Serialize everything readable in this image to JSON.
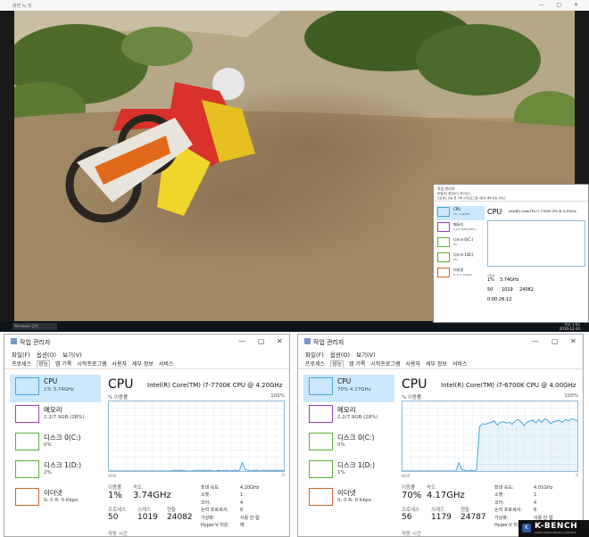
{
  "viewer": {
    "title": "화면 녹 및",
    "window_controls": "—  ▢  ✕"
  },
  "taskbar": {
    "search": "Windows 검색",
    "time": "오후 1:41",
    "date": "2016-12-30"
  },
  "colors": {
    "cpu": "#4aa3d8",
    "memory": "#9b3fbd",
    "disk": "#5cb038",
    "net": "#c9682f"
  },
  "left": {
    "title": "작업 관리자",
    "menu": [
      "파일(F)",
      "옵션(O)",
      "보기(V)"
    ],
    "tabs": [
      "프로세스",
      "성능",
      "앱 기록",
      "시작프로그램",
      "사용자",
      "세부 정보",
      "서비스"
    ],
    "active_tab": 1,
    "sidebar": [
      {
        "name": "CPU",
        "sub": "1% 3.74GHz",
        "icon": "cpu-thumb"
      },
      {
        "name": "메모리",
        "sub": "2.2/7.9GB (28%)",
        "icon": "memory-thumb"
      },
      {
        "name": "디스크 0(C:)",
        "sub": "0%",
        "icon": "disk-thumb"
      },
      {
        "name": "디스크 1(D:)",
        "sub": "2%",
        "icon": "disk-thumb"
      },
      {
        "name": "이더넷",
        "sub": "S: 0 R: 0 Kbps",
        "icon": "ethernet-thumb"
      }
    ],
    "header": "CPU",
    "model": "Intel(R) Core(TM) i7-7700K CPU @ 4.20GHz",
    "ylabel": "% 이용률",
    "ymax": "100%",
    "xlabel": "60초",
    "xmin": "0",
    "usage_label": "이용률",
    "usage": "1%",
    "speed_label": "속도",
    "speed": "3.74GHz",
    "proc_label": "프로세스",
    "proc": "50",
    "threads_label": "스레드",
    "threads": "1019",
    "handles_label": "핸들",
    "handles": "24082",
    "uptime_label": "작동 시간",
    "kv_labels": [
      "최대 속도:",
      "소켓:",
      "코어:",
      "논리 프로세서:",
      "가상화:",
      "Hyper-V 지원:"
    ],
    "kv_values": [
      "4.20GHz",
      "1",
      "4",
      "8",
      "사용 안 함",
      "예"
    ],
    "cpu_graph": [
      0,
      0,
      0,
      0,
      0,
      0,
      0,
      0,
      0,
      0,
      0,
      0,
      0,
      0,
      0,
      0,
      0,
      0,
      0,
      0,
      0,
      0,
      1,
      1,
      1,
      1,
      0,
      0,
      0,
      1,
      1,
      1,
      1,
      1,
      1,
      0,
      0,
      1,
      0,
      1,
      1,
      0,
      1,
      1,
      0,
      12,
      2,
      1,
      0,
      1,
      1,
      0,
      1,
      1,
      1,
      1,
      1,
      1,
      1,
      1
    ]
  },
  "right": {
    "title": "작업 관리자",
    "menu": [
      "파일(F)",
      "옵션(O)",
      "보기(V)"
    ],
    "tabs": [
      "프로세스",
      "성능",
      "앱 기록",
      "시작프로그램",
      "사용자",
      "세부 정보",
      "서비스"
    ],
    "active_tab": 1,
    "sidebar": [
      {
        "name": "CPU",
        "sub": "70% 4.17GHz",
        "icon": "cpu-thumb"
      },
      {
        "name": "메모리",
        "sub": "2.2/7.9GB (28%)",
        "icon": "memory-thumb"
      },
      {
        "name": "디스크 0(C:)",
        "sub": "0%",
        "icon": "disk-thumb"
      },
      {
        "name": "디스크 1(D:)",
        "sub": "1%",
        "icon": "disk-thumb"
      },
      {
        "name": "이더넷",
        "sub": "S: 0 R: 0 Kbps",
        "icon": "ethernet-thumb"
      }
    ],
    "header": "CPU",
    "model": "Intel(R) Core(TM) i7-6700K CPU @ 4.00GHz",
    "ylabel": "% 이용률",
    "ymax": "100%",
    "xlabel": "60초",
    "xmin": "0",
    "usage_label": "이용률",
    "usage": "70%",
    "speed_label": "속도",
    "speed": "4.17GHz",
    "proc_label": "프로세스",
    "proc": "56",
    "threads_label": "스레드",
    "threads": "1179",
    "handles_label": "핸들",
    "handles": "24787",
    "uptime_label": "작동 시간",
    "kv_labels": [
      "최대 속도:",
      "소켓:",
      "코어:",
      "논리 프로세서:",
      "가상화:",
      "Hyper-V 지원:"
    ],
    "kv_values": [
      "4.01GHz",
      "1",
      "4",
      "8",
      "사용 안 함",
      "예"
    ],
    "cpu_graph": [
      0,
      0,
      0,
      0,
      0,
      0,
      0,
      0,
      0,
      0,
      0,
      0,
      0,
      0,
      0,
      0,
      0,
      0,
      0,
      12,
      2,
      1,
      0,
      1,
      0,
      2,
      64,
      68,
      67,
      69,
      70,
      72,
      66,
      70,
      71,
      69,
      70,
      67,
      72,
      74,
      71,
      65,
      70,
      72,
      73,
      69,
      74,
      70,
      75,
      73,
      68,
      71,
      72,
      73,
      70,
      74,
      72,
      75,
      74,
      72
    ]
  },
  "inset": {
    "title": "작업 관리자",
    "menu": "파일(F) 옵션(O) 보기(V)",
    "tabs": "프로세스 성능 앱 기록 시작프로그램 사용자 세부 정보 서비스",
    "header": "CPU",
    "model": "Intel(R) Core(TM) i7-7700K CPU @ 4.20GHz",
    "sidebar": [
      {
        "name": "CPU",
        "sub": "1% 3.74GHz"
      },
      {
        "name": "메모리",
        "sub": "2.2/7.9GB (28%)"
      },
      {
        "name": "디스크 0(C:)",
        "sub": "0%"
      },
      {
        "name": "디스크 1(D:)",
        "sub": "2%"
      },
      {
        "name": "이더넷",
        "sub": "S: 0 R: 0 Kbps"
      }
    ],
    "usage": "1%",
    "speed": "3.74GHz",
    "proc": "50",
    "threads": "1019",
    "handles": "24082",
    "uptime": "0:00:26:12"
  },
  "logo": {
    "text": "K-BENCH",
    "sub": "KOREA BENCHMARK & REVIEW"
  }
}
